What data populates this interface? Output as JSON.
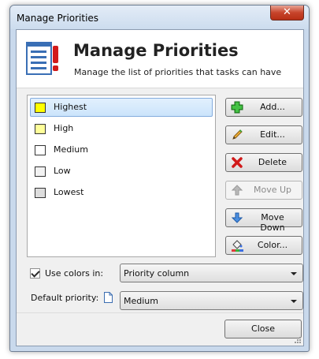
{
  "window": {
    "title": "Manage Priorities",
    "close_glyph": "✕"
  },
  "header": {
    "title": "Manage Priorities",
    "subtitle": "Manage the list of priorities that tasks can have",
    "icon": "priority-list-icon"
  },
  "priorities": [
    {
      "label": "Highest",
      "color": "#ffff00",
      "selected": true
    },
    {
      "label": "High",
      "color": "#ffff99",
      "selected": false
    },
    {
      "label": "Medium",
      "color": "#ffffff",
      "selected": false
    },
    {
      "label": "Low",
      "color": "#f2f2f2",
      "selected": false
    },
    {
      "label": "Lowest",
      "color": "#dddddd",
      "selected": false
    }
  ],
  "buttons": {
    "add": {
      "label": "Add...",
      "icon": "plus-icon",
      "enabled": true
    },
    "edit": {
      "label": "Edit...",
      "icon": "pencil-icon",
      "enabled": true
    },
    "delete": {
      "label": "Delete",
      "icon": "red-x-icon",
      "enabled": true
    },
    "move_up": {
      "label": "Move Up",
      "icon": "arrow-up-icon",
      "enabled": false
    },
    "move_down": {
      "label": "Move Down",
      "icon": "arrow-down-icon",
      "enabled": true
    },
    "color": {
      "label": "Color...",
      "icon": "paint-bucket-icon",
      "enabled": true
    }
  },
  "options": {
    "use_colors_label": "Use colors in:",
    "use_colors_checked": true,
    "use_colors_value": "Priority column",
    "default_priority_label": "Default priority:",
    "default_priority_value": "Medium"
  },
  "footer": {
    "close_label": "Close"
  }
}
